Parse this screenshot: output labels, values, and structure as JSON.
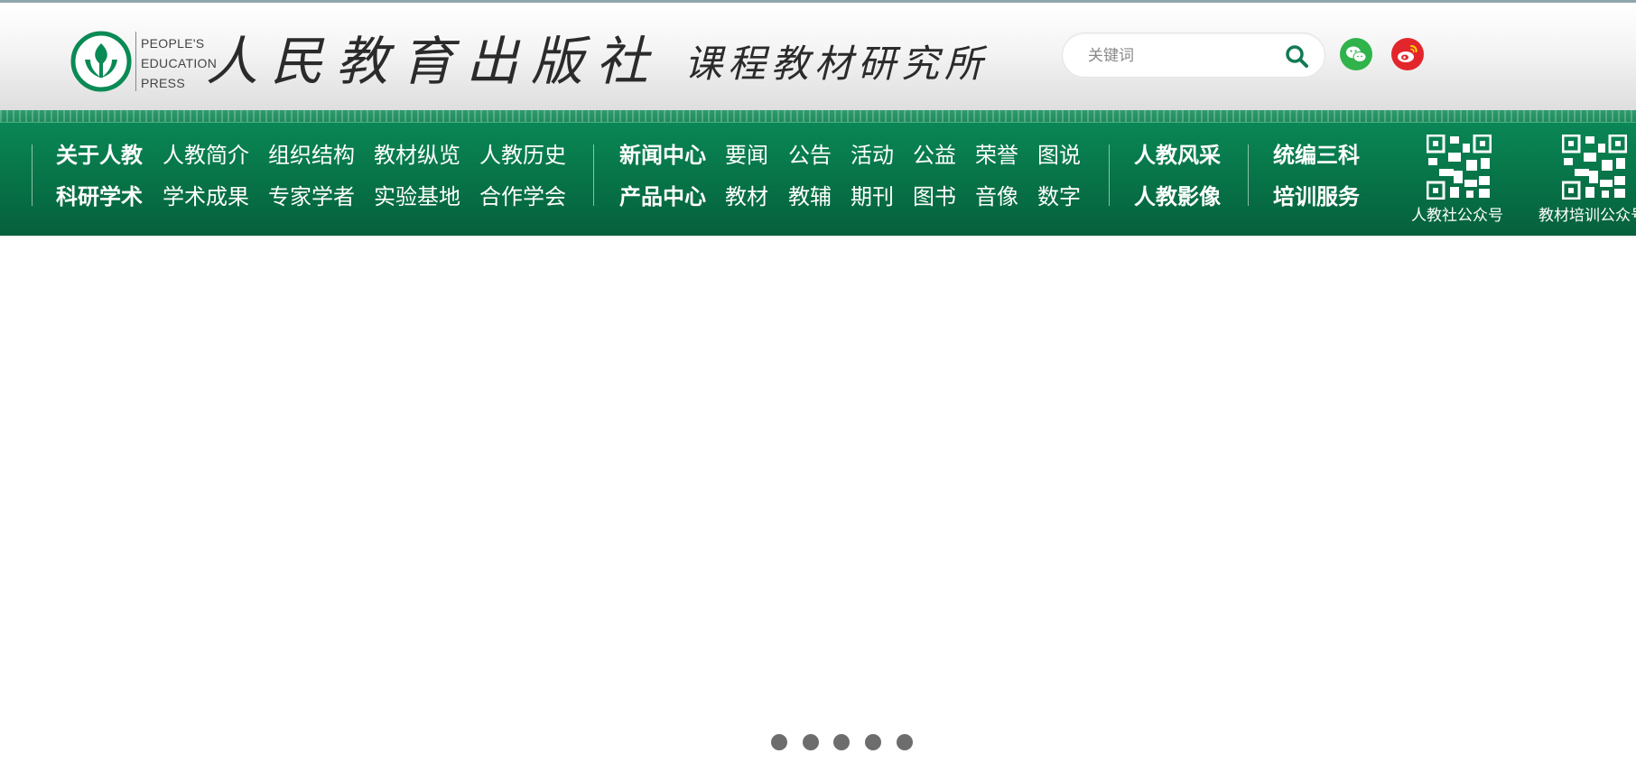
{
  "brand": {
    "english": [
      "PEOPLE'S",
      "EDUCATION",
      "PRESS"
    ],
    "chinese": "人民教育出版社",
    "institute": "课程教材研究所",
    "emblem_color": "#0a8a55"
  },
  "search": {
    "placeholder": "关键词",
    "icon": "search-icon"
  },
  "social": {
    "wechat_icon": "wechat-icon",
    "weibo_icon": "weibo-icon",
    "wechat_color": "#2fb34a",
    "weibo_color": "#e3262b"
  },
  "nav": {
    "group1": {
      "row1": [
        "关于人教",
        "人教简介",
        "组织结构",
        "教材纵览",
        "人教历史"
      ],
      "row2": [
        "科研学术",
        "学术成果",
        "专家学者",
        "实验基地",
        "合作学会"
      ]
    },
    "group2": {
      "row1": [
        "新闻中心",
        "要闻",
        "公告",
        "活动",
        "公益",
        "荣誉",
        "图说"
      ],
      "row2": [
        "产品中心",
        "教材",
        "教辅",
        "期刊",
        "图书",
        "音像",
        "数字"
      ]
    },
    "group3": [
      "人教风采",
      "人教影像"
    ],
    "group4": [
      "统编三科",
      "培训服务"
    ]
  },
  "qr_codes": [
    {
      "label": "人教社公众号",
      "icon": "qr-code-icon"
    },
    {
      "label": "教材培训公众号",
      "icon": "qr-code-icon"
    }
  ],
  "carousel": {
    "slide_count": 5,
    "dot_color": "#6d6d6d"
  },
  "theme": {
    "band_color": "#087a4c",
    "search_icon_color": "#127a52"
  }
}
